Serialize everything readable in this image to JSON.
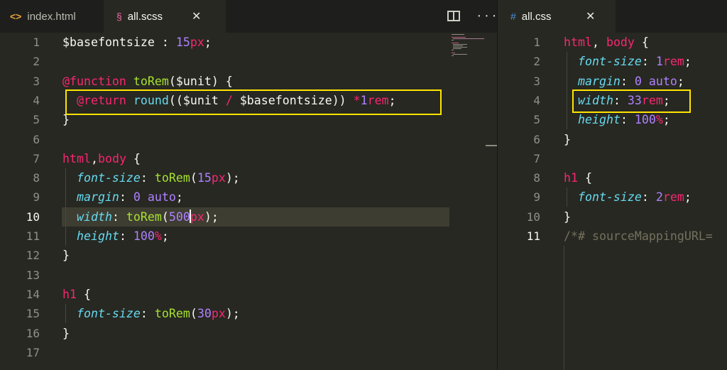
{
  "left_tabs": [
    {
      "label": "index.html",
      "icon": "code-icon"
    },
    {
      "label": "all.scss",
      "icon": "sass-icon",
      "active": true
    }
  ],
  "right_tabs": [
    {
      "label": "all.css",
      "icon": "hash-icon",
      "active": true
    }
  ],
  "toolbar": {
    "split_icon": "split-editor-icon",
    "more_icon": "ellipsis-icon",
    "close_glyph": "✕"
  },
  "scss": {
    "current_line": 10,
    "lines": [
      "$basefontsize : 15px;",
      "",
      "@function toRem($unit) {",
      "  @return round(($unit / $basefontsize)) *1rem;",
      "}",
      "",
      "html,body {",
      "  font-size: toRem(15px);",
      "  margin: 0 auto;",
      "  width: toRem(500px);",
      "  height: 100%;",
      "}",
      "",
      "h1 {",
      "  font-size: toRem(30px);",
      "}",
      ""
    ]
  },
  "css": {
    "lines": [
      "html, body {",
      "  font-size: 1rem;",
      "  margin: 0 auto;",
      "  width: 33rem;",
      "  height: 100%;",
      "}",
      "",
      "h1 {",
      "  font-size: 2rem;",
      "}",
      "/*# sourceMappingURL="
    ]
  },
  "colors": {
    "background": "#272822",
    "highlight": "#ffe400",
    "keyword": "#f92672",
    "number": "#ae81ff",
    "function": "#66d9ef"
  }
}
